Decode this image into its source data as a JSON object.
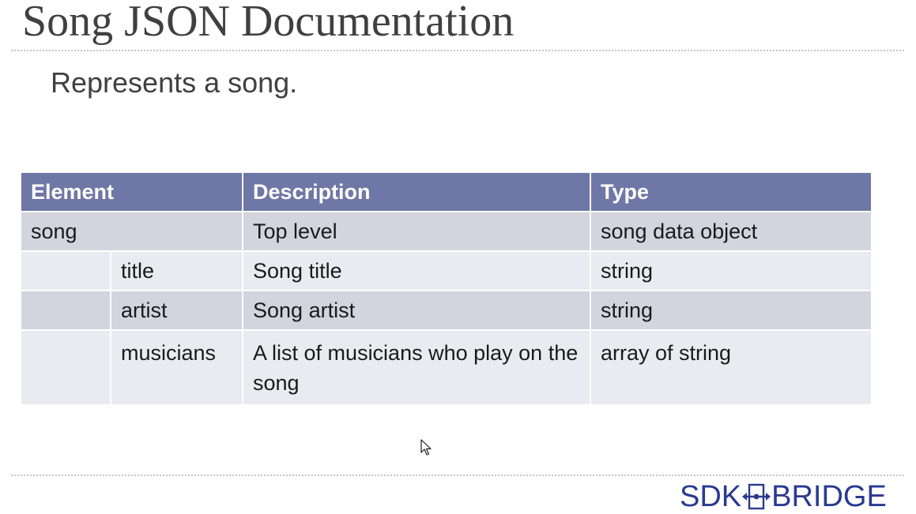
{
  "slide": {
    "title": "Song JSON Documentation",
    "subtitle": "Represents a song."
  },
  "table": {
    "headers": [
      "Element",
      "Description",
      "Type"
    ],
    "rows": [
      {
        "element": "song",
        "subelement": "",
        "description": "Top level",
        "type": "song data object"
      },
      {
        "element": "",
        "subelement": "title",
        "description": "Song title",
        "type": "string"
      },
      {
        "element": "",
        "subelement": "artist",
        "description": "Song artist",
        "type": "string"
      },
      {
        "element": "",
        "subelement": "musicians",
        "description": "A list of musicians who play on the song",
        "type": "array of string"
      }
    ]
  },
  "logo": {
    "text_left": "SDK",
    "text_right": "BRIDGE",
    "icon": "bridge-arrows-icon",
    "color": "#2b3a8f"
  },
  "colors": {
    "header_bg": "#6e77a5",
    "row_dark": "#d3d4de",
    "row_light": "#eaebf0",
    "title_text": "#404040"
  }
}
